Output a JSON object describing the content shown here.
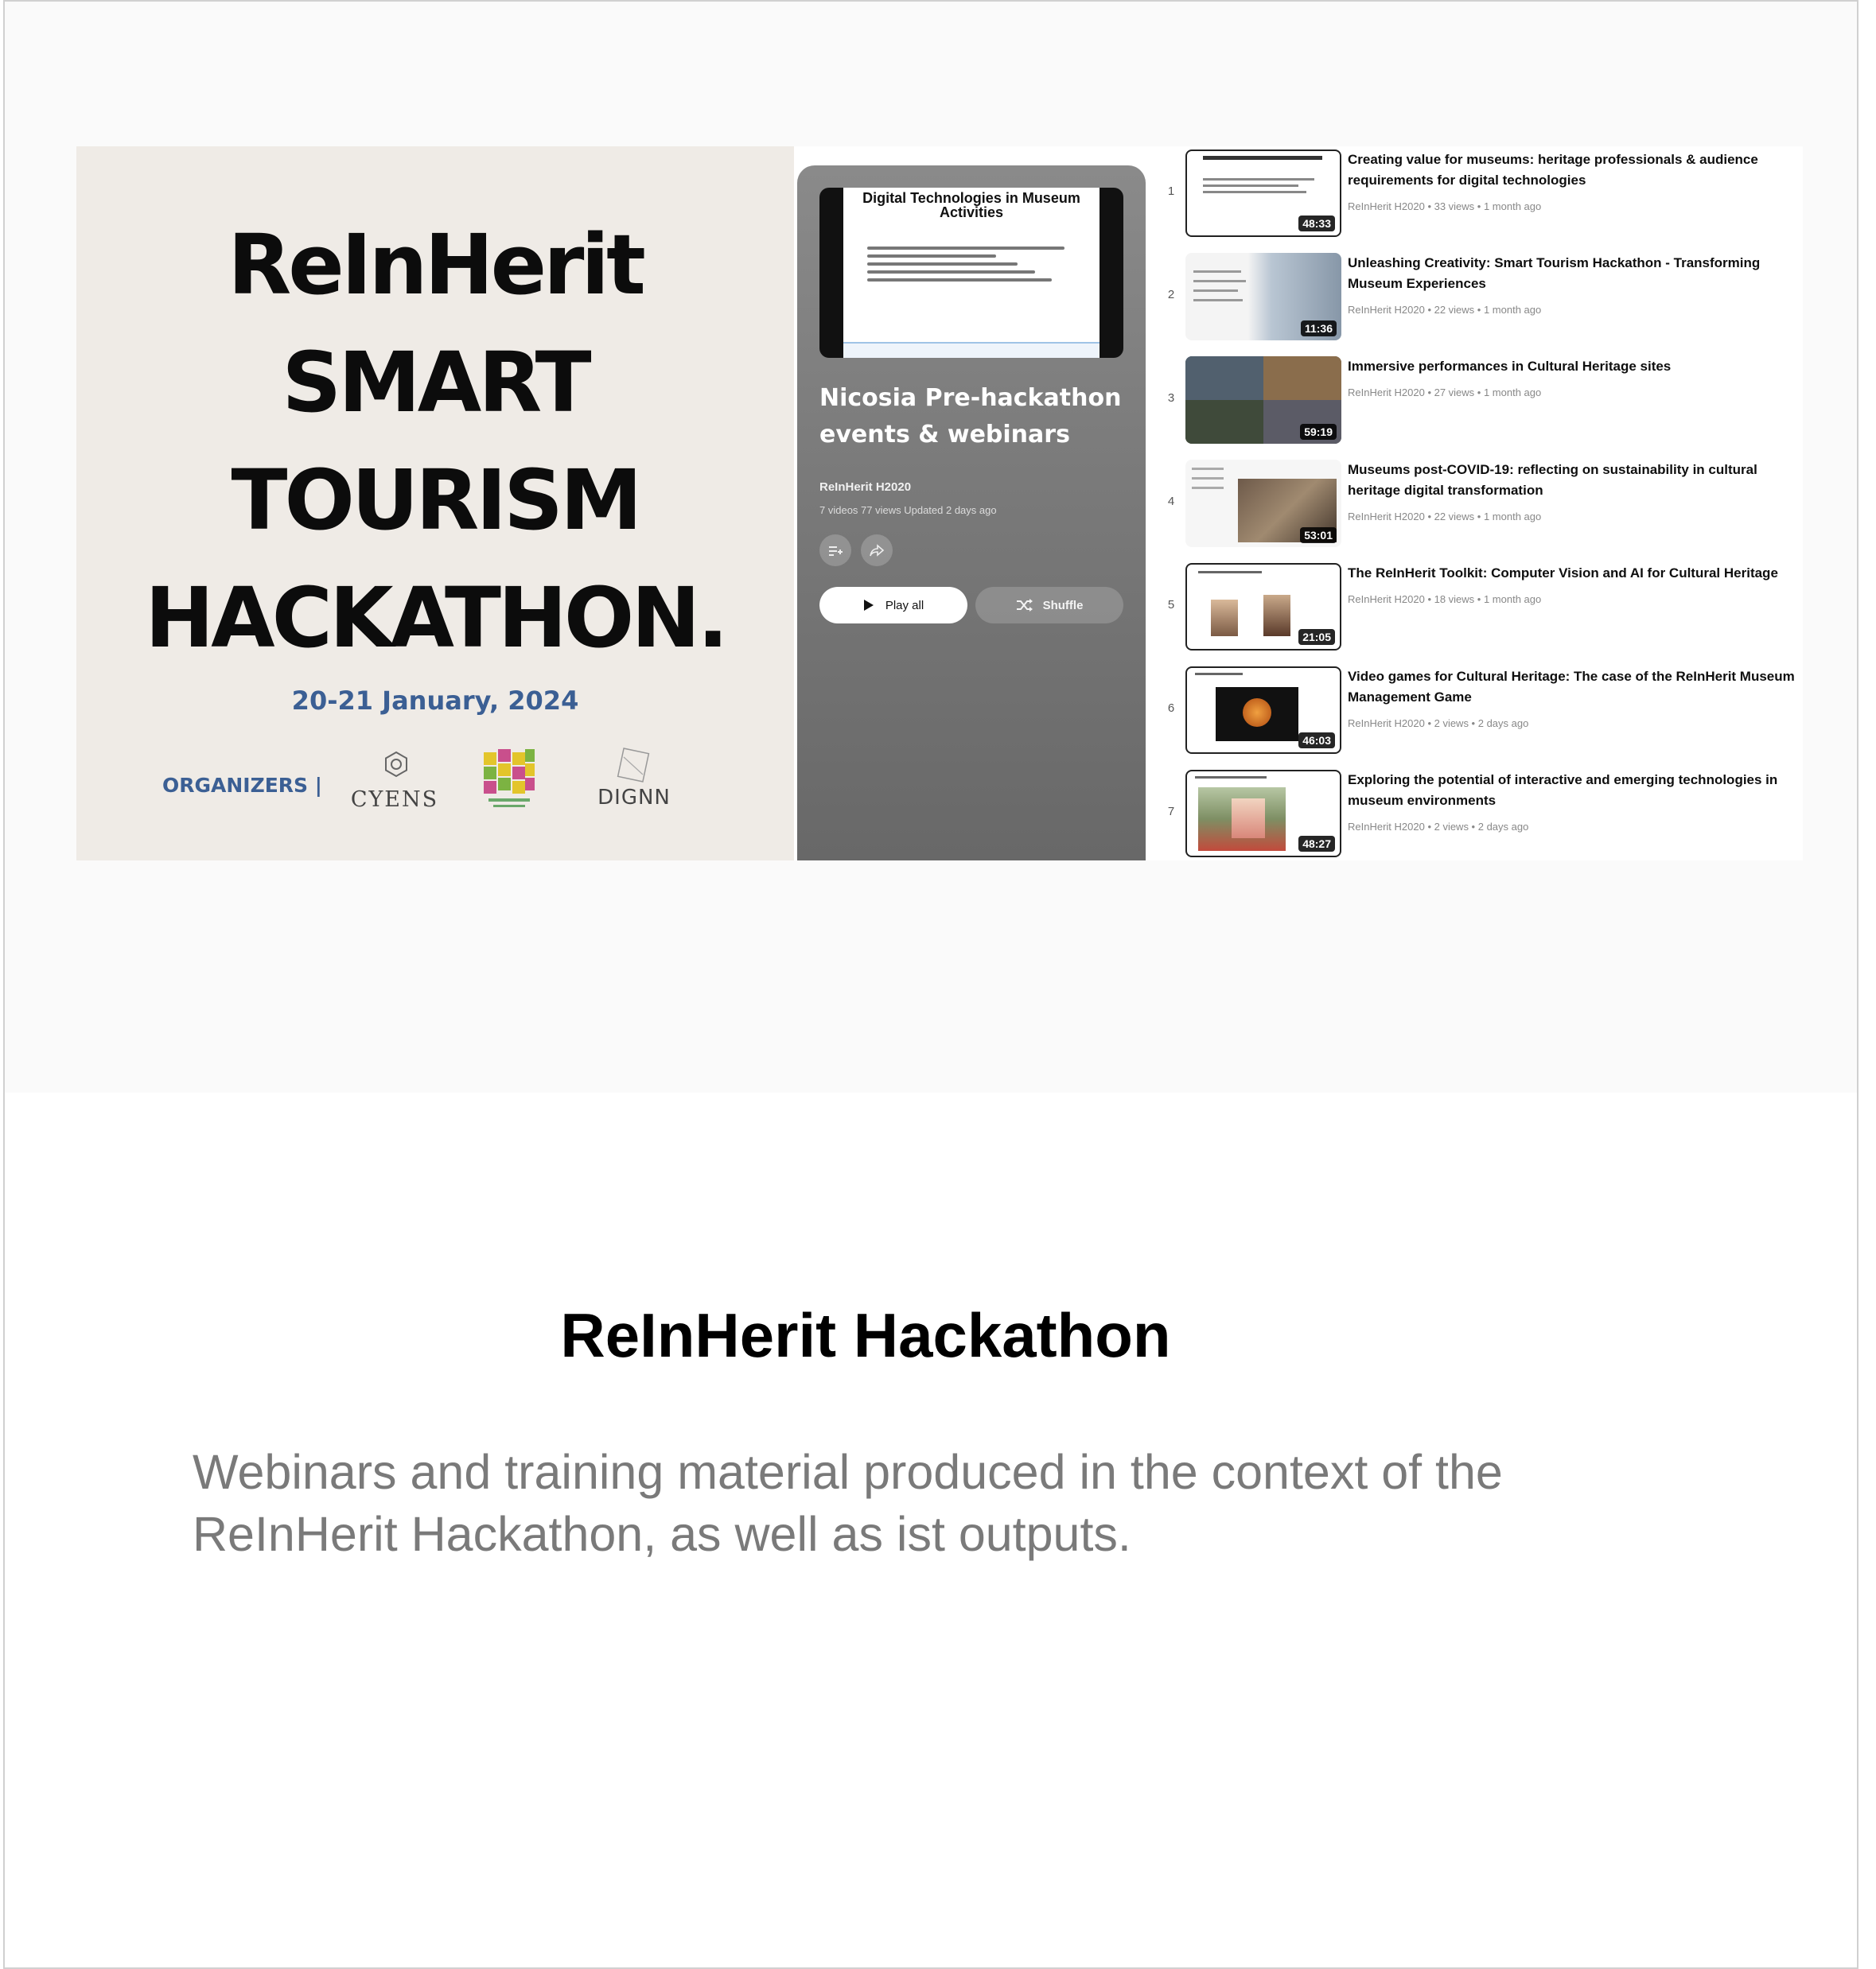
{
  "poster": {
    "lines": [
      "ReInHerit",
      "SMART",
      "TOURISM",
      "HACKATHON."
    ],
    "date": "20-21 January, 2024",
    "organizers_label": "ORGANIZERS |",
    "logos": [
      "CYENS",
      "DIGNN"
    ],
    "colors": {
      "background": "#efebe6",
      "accent": "#3b5f94"
    }
  },
  "playlist": {
    "thumbnail_title": "Digital Technologies in Museum Activities",
    "title": "Nicosia Pre-hackathon events & webinars",
    "owner": "ReInHerit H2020",
    "stats": "7 videos  77 views  Updated 2 days ago",
    "icons": [
      "add-to-queue-icon",
      "share-icon"
    ],
    "play_all_label": "Play all",
    "shuffle_label": "Shuffle"
  },
  "videos": [
    {
      "index": "1",
      "title": "Creating value for museums: heritage professionals & audience requirements for digital technologies",
      "meta": "ReInHerit H2020 • 33 views • 1 month ago",
      "duration": "48:33"
    },
    {
      "index": "2",
      "title": "Unleashing Creativity: Smart Tourism Hackathon - Transforming Museum Experiences",
      "meta": "ReInHerit H2020 • 22 views • 1 month ago",
      "duration": "11:36"
    },
    {
      "index": "3",
      "title": "Immersive performances in Cultural Heritage sites",
      "meta": "ReInHerit H2020 • 27 views • 1 month ago",
      "duration": "59:19"
    },
    {
      "index": "4",
      "title": "Museums post-COVID-19: reflecting on sustainability in cultural heritage digital transformation",
      "meta": "ReInHerit H2020 • 22 views • 1 month ago",
      "duration": "53:01"
    },
    {
      "index": "5",
      "title": "The ReInHerit Toolkit: Computer Vision and AI for Cultural Heritage",
      "meta": "ReInHerit H2020 • 18 views • 1 month ago",
      "duration": "21:05"
    },
    {
      "index": "6",
      "title": "Video games for Cultural Heritage: The case of the ReInHerit Museum Management Game",
      "meta": "ReInHerit H2020 • 2 views • 2 days ago",
      "duration": "46:03"
    },
    {
      "index": "7",
      "title": "Exploring the potential of interactive and emerging technologies in museum environments",
      "meta": "ReInHerit H2020 • 2 views • 2 days ago",
      "duration": "48:27"
    }
  ],
  "heading": "ReInHerit Hackathon",
  "description": "Webinars and training material produced in the context of the ReInHerit Hackathon, as well as ist outputs."
}
